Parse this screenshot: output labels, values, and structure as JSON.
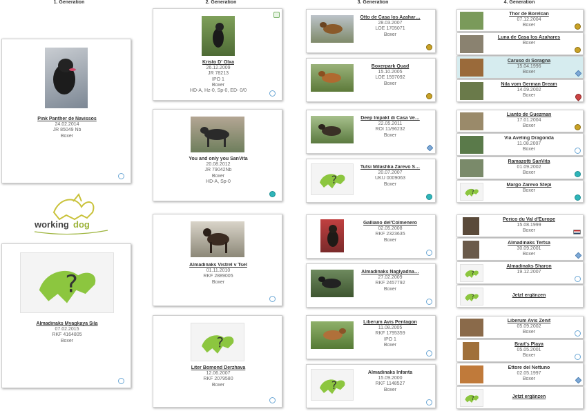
{
  "headers": [
    "1. Generation",
    "2. Generation",
    "3. Generation",
    "4. Generation"
  ],
  "logo": {
    "word1": "working",
    "word2": "dog"
  },
  "gen1": [
    {
      "name": "Pink Panther de Navissos",
      "lines": [
        "24.02.2014",
        "JR 85049 Nb",
        "Boxer"
      ],
      "icon": "blue-circle-icon"
    },
    {
      "name": "Almadinaks Myagkaya Sila",
      "lines": [
        "07.02.2015",
        "RKF 4164805",
        "Boxer"
      ],
      "icon": "blue-circle-icon"
    }
  ],
  "gen2": [
    {
      "name": "Kristo D' Olxa",
      "lines": [
        "26.12.2009",
        "JR 78213",
        "IPO 1",
        "Boxer",
        "HD-A, Hz-0, Sp-0, ED- 0/0"
      ],
      "icon": "blue-circle-icon",
      "top_icon": "play-icon"
    },
    {
      "name": "You and only you SanVita",
      "lines": [
        "20.08.2012",
        "JR 79042Nb",
        "Boxer",
        "HD-A, Sp-0"
      ],
      "icon": "teal-circle-icon"
    },
    {
      "name": "Almadinaks Vistrel v Tsel",
      "lines": [
        "01.11.2010",
        "RKF 2889005",
        "Boxer"
      ],
      "icon": "blue-circle-icon"
    },
    {
      "name": "Liter Bomond Derzhava",
      "lines": [
        "12.06.2007",
        "RKF 2079580",
        "Boxer"
      ],
      "icon": "blue-circle-icon"
    }
  ],
  "gen3": [
    {
      "name": "Otto de Casa los Azahar…",
      "lines": [
        "28.03.2007",
        "LOE 1705071",
        "Boxer"
      ],
      "icon": "gold-medal-icon"
    },
    {
      "name": "Boxerpark Quad",
      "lines": [
        "15.10.2005",
        "LOE 1597092",
        "Boxer"
      ],
      "icon": "gold-medal-icon"
    },
    {
      "name": "Deep Impakt di Casa Ve…",
      "lines": [
        "22.05.2011",
        "ROI 11/96232",
        "Boxer"
      ],
      "icon": "diamond-icon"
    },
    {
      "name": "Tutsi Milashka Zarevo S…",
      "lines": [
        "20.07.2007",
        "UKU 0009063",
        "Boxer"
      ],
      "icon": "teal-circle-icon"
    },
    {
      "name": "Galliano del'Colmenero",
      "lines": [
        "02.05.2008",
        "RKF 2323635",
        "Boxer"
      ],
      "icon": "blue-circle-icon"
    },
    {
      "name": "Almadinaks Naglyadna…",
      "lines": [
        "27.02.2009",
        "RKF 2457792",
        "Boxer"
      ],
      "icon": "blue-circle-icon"
    },
    {
      "name": "Liberum Avis Pentagon",
      "lines": [
        "11.08.2005",
        "RKF 1795359",
        "IPO 1",
        "Boxer"
      ],
      "icon": "blue-circle-icon"
    },
    {
      "name": "Almadinaks Infanta",
      "lines": [
        "15.09.2000",
        "RKF 1148527",
        "Boxer"
      ],
      "icon": "blue-circle-icon"
    }
  ],
  "gen4": [
    {
      "name": "Thor de Borelcan",
      "lines": [
        "07.12.2004",
        "Boxer"
      ],
      "icon": "gold-medal-icon"
    },
    {
      "name": "Luna de Casa los Azahares",
      "lines": [
        "Boxer"
      ],
      "icon": "gold-medal-icon"
    },
    {
      "name": "Caruso di Soragna",
      "lines": [
        "15.04.1996",
        "Boxer"
      ],
      "icon": "diamond-icon"
    },
    {
      "name": "Nila vom German Dream",
      "lines": [
        "14.09.2002",
        "Boxer"
      ],
      "icon": "pin-icon"
    },
    {
      "name": "Lianto de Guezman",
      "lines": [
        "17.01.2004",
        "Boxer"
      ],
      "icon": "gold-medal-icon"
    },
    {
      "name": "Via Aveling Dragonda",
      "lines": [
        "11.08.2007",
        "Boxer"
      ],
      "icon": "blue-circle-icon"
    },
    {
      "name": "Ramazotti SanVita",
      "lines": [
        "01.09.2002",
        "Boxer"
      ],
      "icon": "teal-circle-icon"
    },
    {
      "name": "Margo Zarevo Stepi",
      "lines": [
        "Boxer"
      ],
      "icon": "teal-circle-icon"
    },
    {
      "name": "Perico du Val d'Europe",
      "lines": [
        "15.08.1999",
        "Boxer"
      ],
      "icon": "flag-icon"
    },
    {
      "name": "Almadinaks Tertsa",
      "lines": [
        "30.09.2001",
        "Boxer"
      ],
      "icon": "diamond-icon"
    },
    {
      "name": "Almadinaks Sharon",
      "lines": [
        "19.12.2007"
      ],
      "icon": "blue-circle-icon"
    },
    {
      "name": "Jetzt ergänzen",
      "lines": [],
      "icon": ""
    },
    {
      "name": "Liberum Avis Zenit",
      "lines": [
        "05.09.2002",
        "Boxer"
      ],
      "icon": "blue-circle-icon"
    },
    {
      "name": "Brait's Playa",
      "lines": [
        "05.05.2001",
        "Boxer"
      ],
      "icon": "blue-circle-icon"
    },
    {
      "name": "Ettore del Nettuno",
      "lines": [
        "02.05.1997",
        "Boxer"
      ],
      "icon": "diamond-icon"
    },
    {
      "name": "Jetzt ergänzen",
      "lines": [],
      "icon": ""
    }
  ]
}
